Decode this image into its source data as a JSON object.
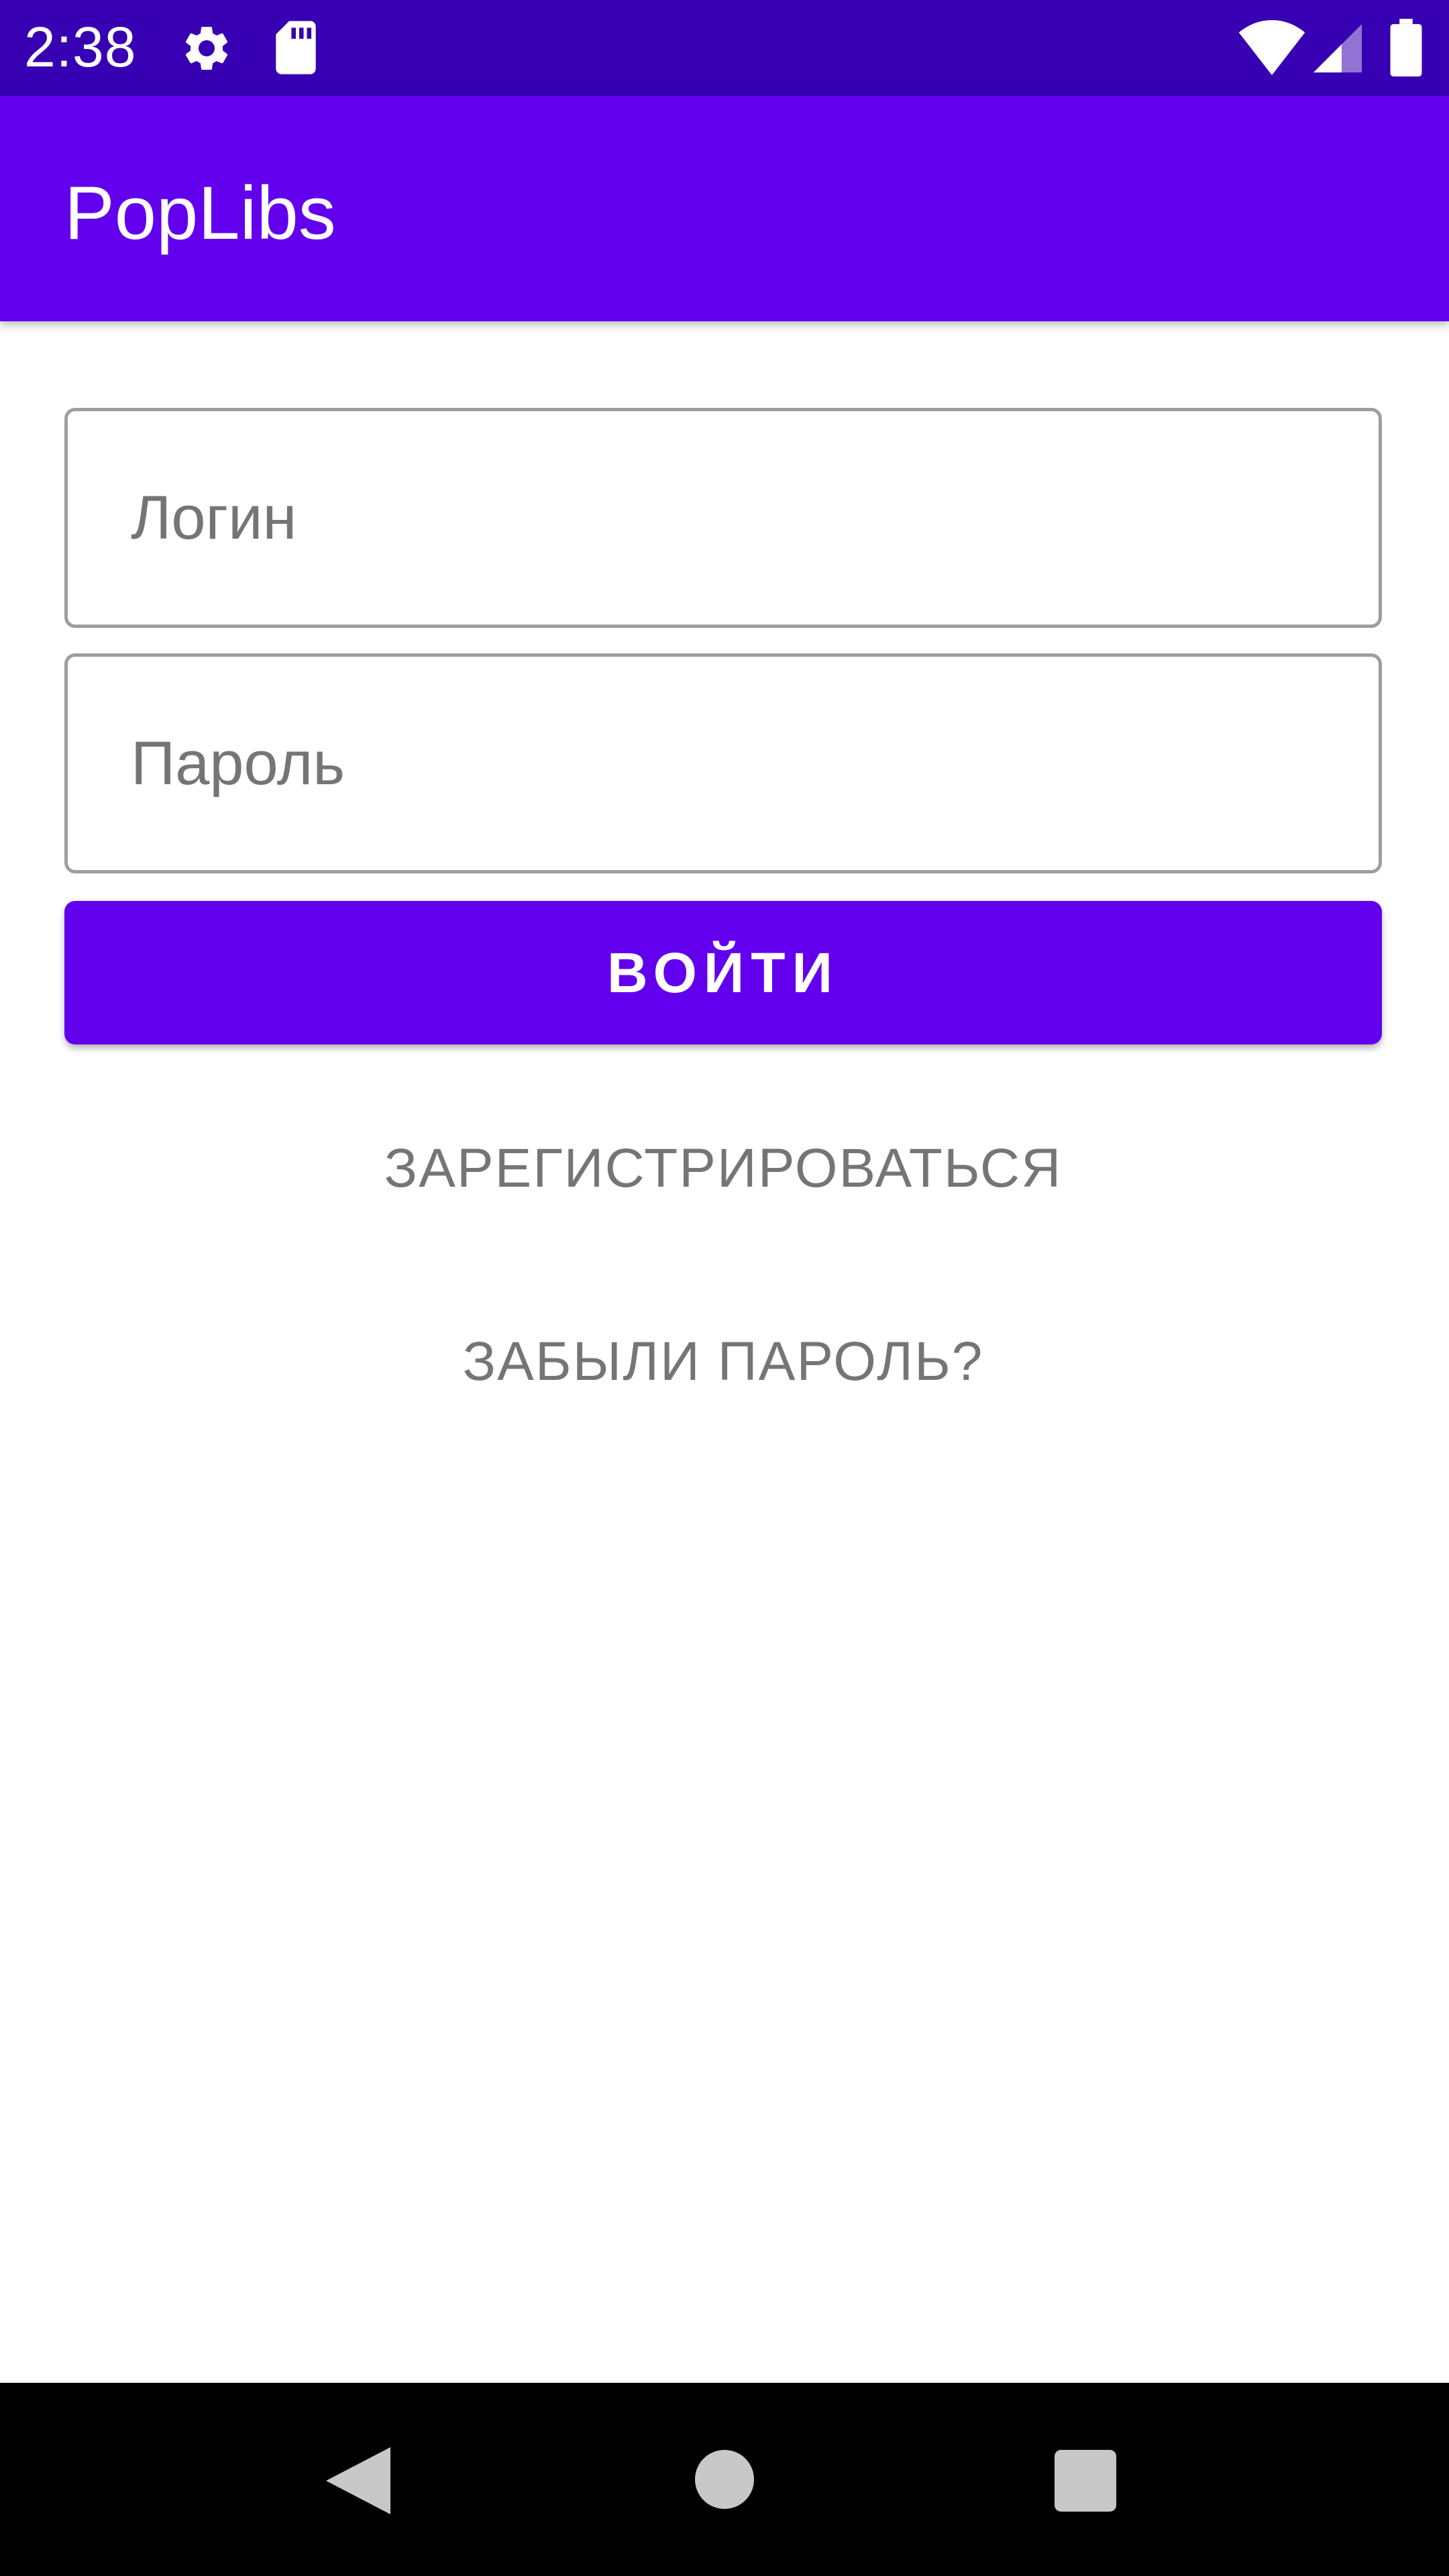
{
  "status_bar": {
    "time": "2:38",
    "icons": [
      "settings-icon",
      "sd-card-icon",
      "wifi-icon",
      "cell-signal-icon",
      "battery-icon"
    ],
    "background": "#3700b3"
  },
  "app_bar": {
    "title": "PopLibs",
    "background": "#6200ee"
  },
  "form": {
    "login_placeholder": "Логин",
    "login_value": "",
    "password_placeholder": "Пароль",
    "password_value": "",
    "login_button_label": "ВОЙТИ",
    "register_label": "ЗАРЕГИСТРИРОВАТЬСЯ",
    "forgot_password_label": "ЗАБЫЛИ ПАРОЛЬ?",
    "accent_color": "#6200ee"
  },
  "nav_bar": {
    "icons": [
      "back-icon",
      "home-icon",
      "recents-icon"
    ],
    "background": "#000000"
  }
}
